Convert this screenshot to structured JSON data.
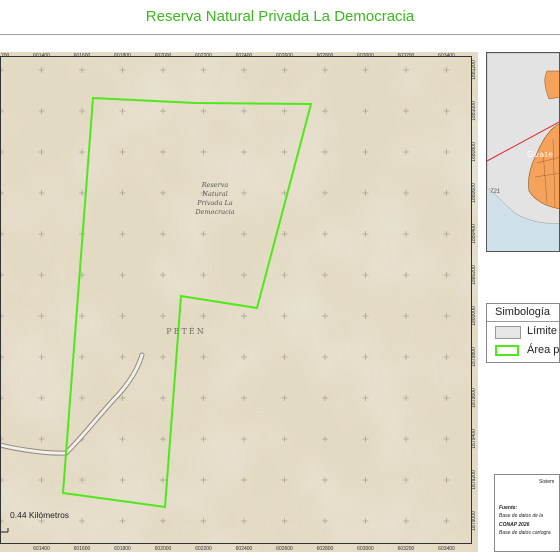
{
  "title": "Reserva Natural Privada La Democracia",
  "map": {
    "reserve_label": [
      "Reserva",
      "Natural",
      "Privada La",
      "Democracia"
    ],
    "region_label": "PETÉN",
    "scale_label": "0.44 Kilómetros",
    "x_ticks": [
      "601200",
      "601400",
      "601600",
      "601800",
      "602000",
      "602200",
      "602400",
      "602600",
      "602800",
      "603000",
      "603200",
      "603400"
    ],
    "x_ticks_bottom": [
      "601400",
      "601600",
      "601800",
      "602000",
      "602200",
      "602400",
      "602600",
      "602800",
      "603000",
      "603200",
      "603400"
    ],
    "y_ticks": [
      "1881200",
      "1881000",
      "1880800",
      "1880600",
      "1880400",
      "1880200",
      "1880000",
      "1879800",
      "1879600",
      "1879400",
      "1879200",
      "1879000"
    ],
    "colors": {
      "background": "#e3dac3",
      "polygon": "#4fe81a",
      "road": "#f3efe6",
      "grid": "#9a958a"
    }
  },
  "inset": {
    "country_label": "Guate",
    "number_label": "721",
    "colors": {
      "land": "#e3e3e3",
      "country": "#f5a35c",
      "ocean": "#cfe0ea",
      "pointer": "#e0262b"
    }
  },
  "legend": {
    "title": "Simbología",
    "items": [
      {
        "label": "Límite"
      },
      {
        "label": "Área pr"
      }
    ]
  },
  "source": {
    "system": "Sistem",
    "fuente": "Fuente:",
    "lines": [
      "Base de datos de la",
      "CONAP 2026",
      "Base de datos cartogra"
    ]
  }
}
